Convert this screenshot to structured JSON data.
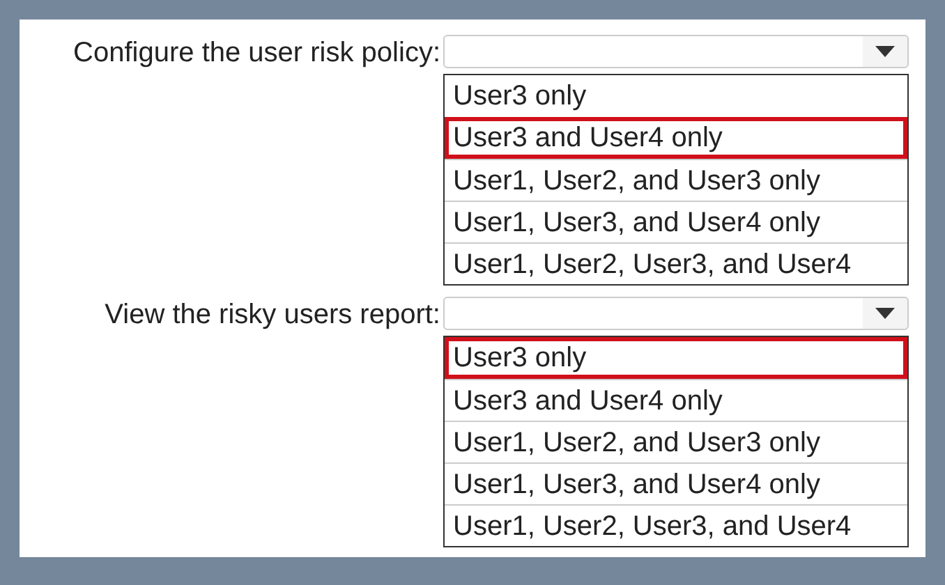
{
  "questions": [
    {
      "label": "Configure the user risk policy:",
      "options": [
        {
          "text": "User3 only",
          "selected": false
        },
        {
          "text": "User3 and User4 only",
          "selected": true
        },
        {
          "text": "User1, User2, and User3 only",
          "selected": false
        },
        {
          "text": "User1, User3, and User4 only",
          "selected": false
        },
        {
          "text": "User1, User2, User3, and User4",
          "selected": false
        }
      ]
    },
    {
      "label": "View the risky users report:",
      "options": [
        {
          "text": "User3 only",
          "selected": true
        },
        {
          "text": "User3 and User4 only",
          "selected": false
        },
        {
          "text": "User1, User2, and User3 only",
          "selected": false
        },
        {
          "text": "User1, User3, and User4 only",
          "selected": false
        },
        {
          "text": "User1, User2, User3, and User4",
          "selected": false
        }
      ]
    }
  ]
}
